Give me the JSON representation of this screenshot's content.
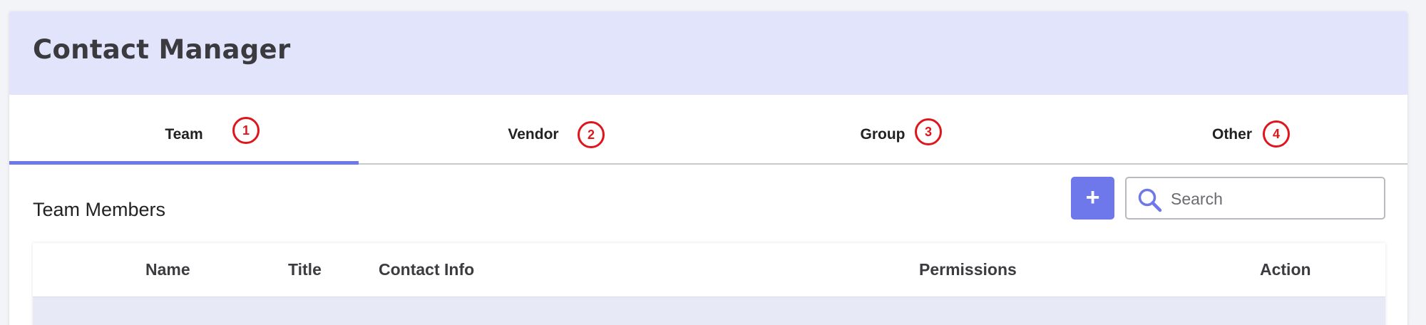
{
  "app": {
    "title": "Contact Manager"
  },
  "tabs": [
    {
      "label": "Team",
      "badge": "1",
      "active": true
    },
    {
      "label": "Vendor",
      "badge": "2",
      "active": false
    },
    {
      "label": "Group",
      "badge": "3",
      "active": false
    },
    {
      "label": "Other",
      "badge": "4",
      "active": false
    }
  ],
  "section": {
    "title": "Team Members"
  },
  "toolbar": {
    "add_label": "+",
    "search_placeholder": "Search",
    "search_icon": "search-icon"
  },
  "table": {
    "columns": [
      "Name",
      "Title",
      "Contact Info",
      "Permissions",
      "Action"
    ],
    "rows": []
  },
  "colors": {
    "header_bg": "#e2e4fb",
    "accent": "#6f78ea",
    "badge_red": "#e0151b"
  }
}
